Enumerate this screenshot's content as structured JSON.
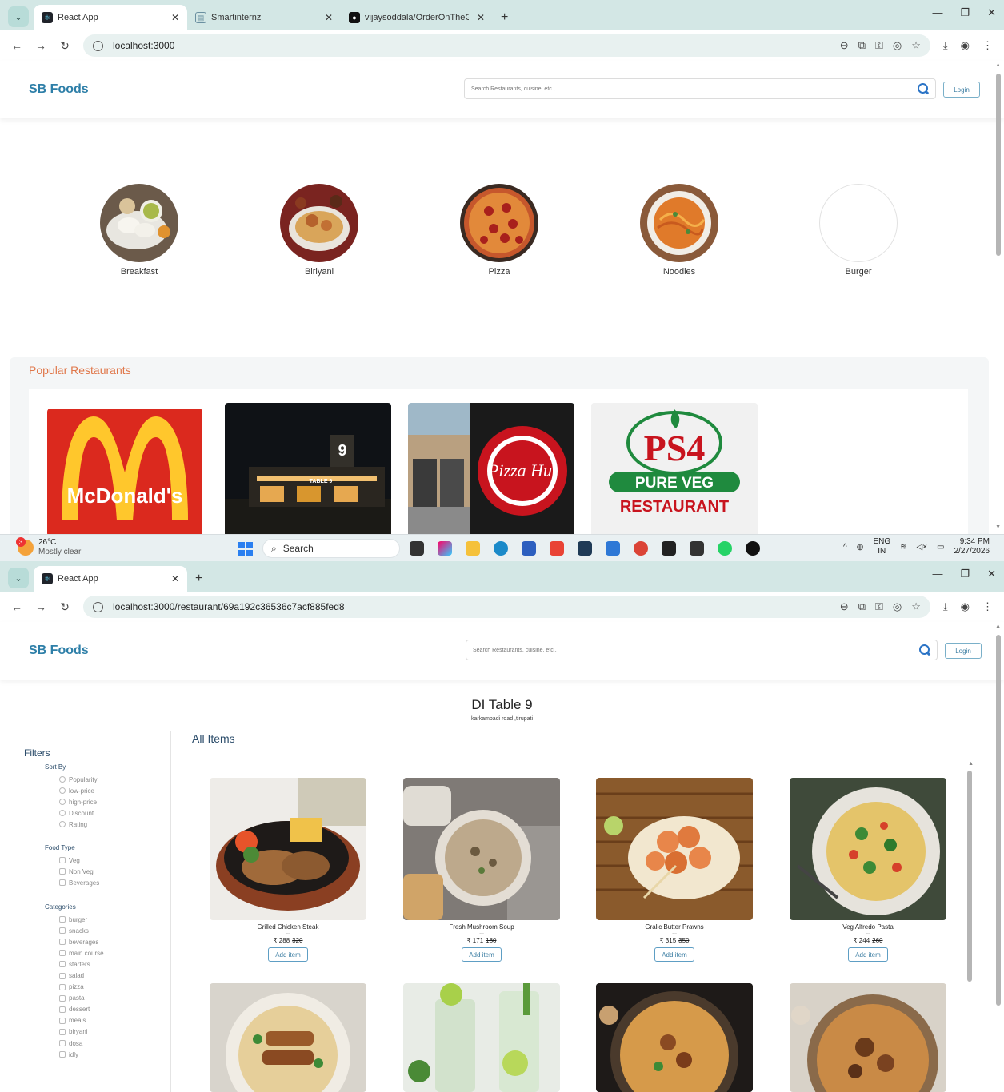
{
  "window1": {
    "tabs": [
      {
        "title": "React App",
        "favicon": "react-icon"
      },
      {
        "title": "Smartinternz",
        "favicon": "document-icon"
      },
      {
        "title": "vijaysoddala/OrderOnTheGo-Vi",
        "favicon": "github-icon"
      }
    ],
    "url": "localhost:3000",
    "logo": "SB Foods",
    "search_placeholder": "Search Restaurants, cuisine, etc.,",
    "login_label": "Login",
    "categories": [
      {
        "label": "Breakfast"
      },
      {
        "label": "Biriyani"
      },
      {
        "label": "Pizza"
      },
      {
        "label": "Noodles"
      },
      {
        "label": "Burger"
      }
    ],
    "popular_title": "Popular Restaurants",
    "restaurants": [
      {
        "logo_text": "McDonald's"
      },
      {
        "logo_text": "TABLE 9"
      },
      {
        "logo_text": "Pizza Hut"
      },
      {
        "logo_text_1": "PS4",
        "logo_text_2": "PURE VEG",
        "logo_text_3": "RESTAURANT"
      }
    ]
  },
  "taskbar": {
    "weather_badge": "3",
    "temperature": "26°C",
    "weather_desc": "Mostly clear",
    "search_label": "Search",
    "lang_1": "ENG",
    "lang_2": "IN",
    "time": "9:34 PM",
    "date": "2/27/2026"
  },
  "window2": {
    "tabs": [
      {
        "title": "React App",
        "favicon": "react-icon"
      }
    ],
    "url": "localhost:3000/restaurant/69a192c36536c7acf885fed8",
    "logo": "SB Foods",
    "search_placeholder": "Search Restaurants, cuisine, etc.,",
    "login_label": "Login",
    "restaurant_name": "DI Table 9",
    "restaurant_address": "karkambadi road ,tirupati",
    "filters_title": "Filters",
    "sort_by": {
      "heading": "Sort By",
      "options": [
        "Popularity",
        "low-price",
        "high-price",
        "Discount",
        "Rating"
      ]
    },
    "food_type": {
      "heading": "Food Type",
      "options": [
        "Veg",
        "Non Veg",
        "Beverages"
      ]
    },
    "categories": {
      "heading": "Categories",
      "options": [
        "burger",
        "snacks",
        "beverages",
        "main course",
        "starters",
        "salad",
        "pizza",
        "pasta",
        "dessert",
        "meals",
        "biryani",
        "dosa",
        "idly"
      ]
    },
    "all_items_title": "All Items",
    "items": [
      {
        "name": "Grilled Chicken Steak",
        "dots": "...",
        "price": "₹ 288",
        "old_price": "320",
        "button": "Add item"
      },
      {
        "name": "Fresh Mushroom Soup",
        "dots": "...",
        "price": "₹ 171",
        "old_price": "180",
        "button": "Add item"
      },
      {
        "name": "Gralic Butter Prawns",
        "dots": "...",
        "price": "₹ 315",
        "old_price": "350",
        "button": "Add item"
      },
      {
        "name": "Veg Alfredo Pasta",
        "dots": "...",
        "price": "₹ 244",
        "old_price": "260",
        "button": "Add item"
      }
    ]
  },
  "colors": {
    "accent_blue": "#2e7fa8",
    "popular_orange": "#e0774a",
    "mcd_red": "#db291e",
    "mcd_yellow": "#ffc72c",
    "ps4_green": "#1f8a3e",
    "ps4_red": "#c8141e"
  }
}
